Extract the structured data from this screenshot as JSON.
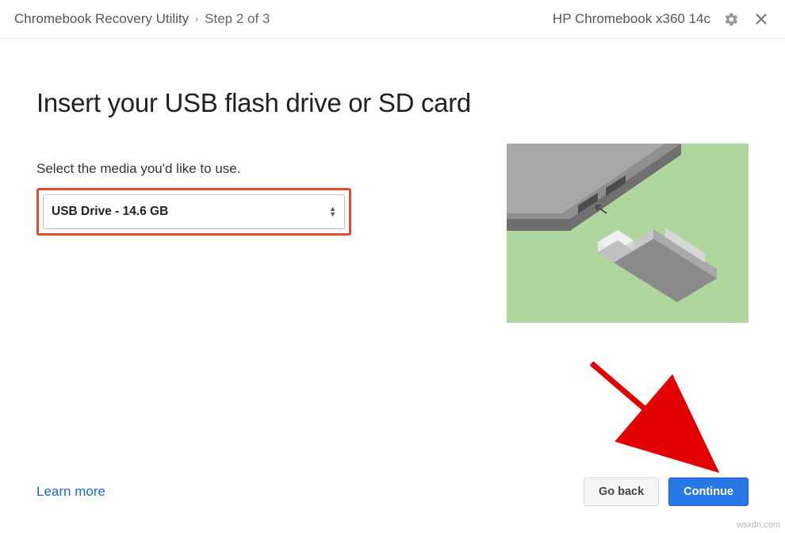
{
  "header": {
    "app_name": "Chromebook Recovery Utility",
    "step_label": "Step 2 of 3",
    "device_name": "HP Chromebook x360 14c"
  },
  "page": {
    "title": "Insert your USB flash drive or SD card",
    "instruction": "Select the media you'd like to use.",
    "selected_media": "USB Drive - 14.6 GB"
  },
  "footer": {
    "learn_more": "Learn more",
    "go_back": "Go back",
    "continue": "Continue"
  },
  "watermark": "wsxdn.com"
}
